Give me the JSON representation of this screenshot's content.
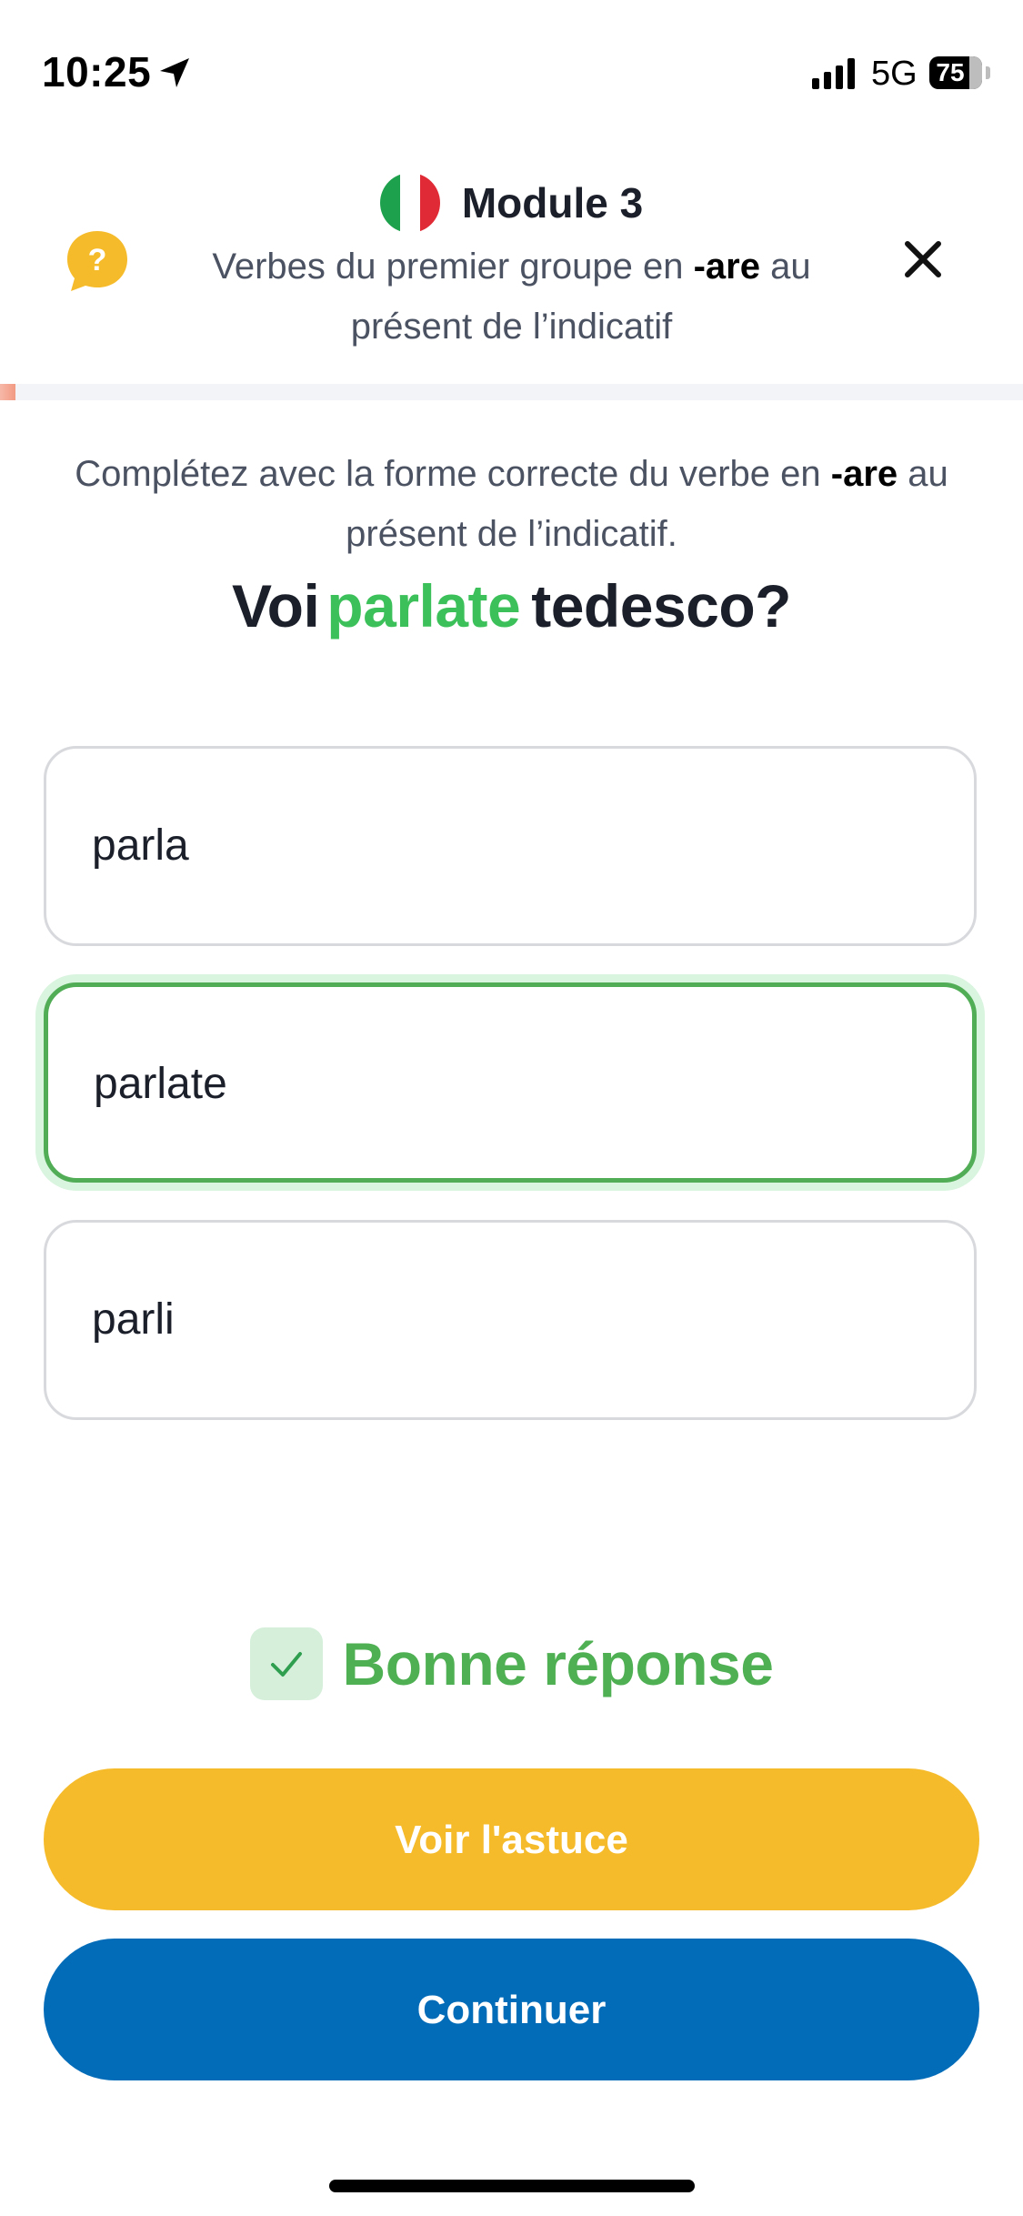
{
  "status_bar": {
    "time": "10:25",
    "network": "5G",
    "battery_level": "75"
  },
  "header": {
    "module_title": "Module 3",
    "subtitle_part1": "Verbes du premier groupe en ",
    "subtitle_emphasis": "-are",
    "subtitle_part2": " au présent de l’indicatif",
    "icons": {
      "help": "help-bubble-icon",
      "close": "close-icon",
      "flag": "italian-flag-icon"
    }
  },
  "progress": {
    "fraction": 0.015
  },
  "exercise": {
    "instruction_part1": "Complétez avec la forme correcte du verbe en ",
    "instruction_emphasis": "-are",
    "instruction_part2": " au présent de l’indicatif.",
    "question_before": "Voi",
    "question_answer": "parlate",
    "question_after": "tedesco?",
    "options": [
      {
        "label": "parla",
        "state": "default"
      },
      {
        "label": "parlate",
        "state": "correct"
      },
      {
        "label": "parli",
        "state": "default"
      }
    ]
  },
  "result": {
    "label": "Bonne réponse"
  },
  "actions": {
    "hint_label": "Voir l'astuce",
    "continue_label": "Continuer"
  },
  "colors": {
    "correct_green": "#4fb053",
    "hint_yellow": "#f6bb2a",
    "continue_blue": "#036cb9",
    "italian_green": "#1ea14d",
    "italian_red": "#e02b36"
  }
}
